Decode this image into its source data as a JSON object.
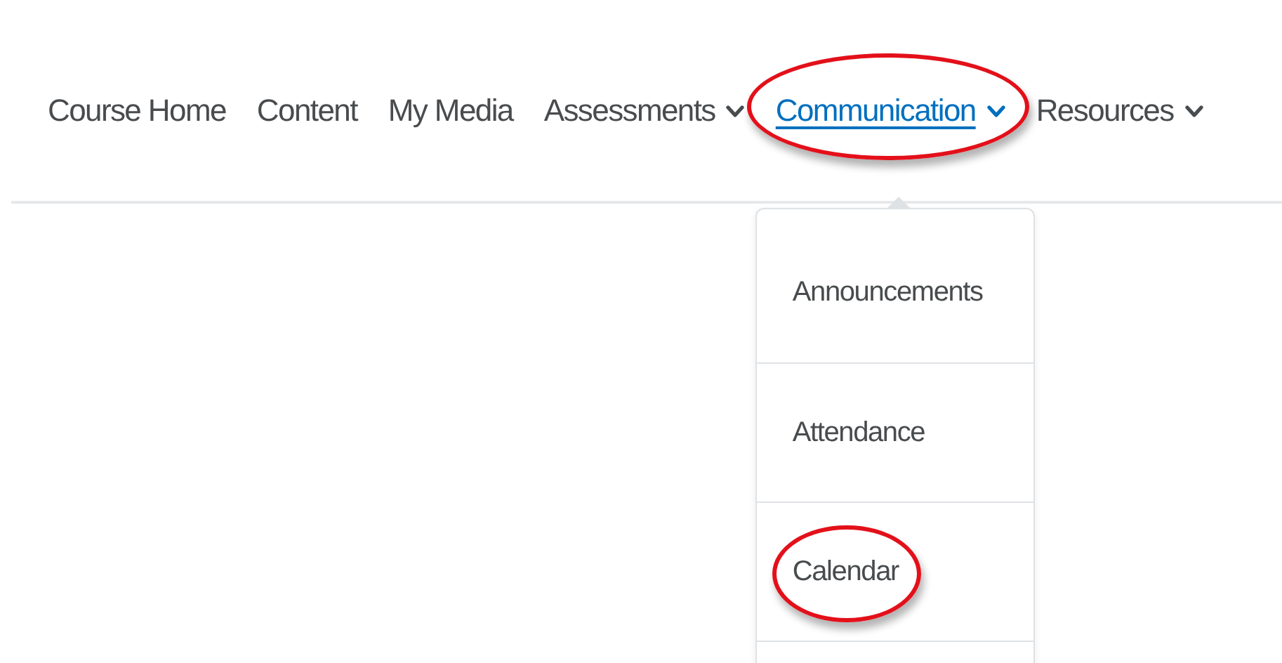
{
  "nav": {
    "items": [
      {
        "label": "Course Home",
        "has_menu": false,
        "selected": false,
        "highlighted": false
      },
      {
        "label": "Content",
        "has_menu": false,
        "selected": false,
        "highlighted": false
      },
      {
        "label": "My Media",
        "has_menu": false,
        "selected": false,
        "highlighted": false
      },
      {
        "label": "Assessments",
        "has_menu": true,
        "selected": false,
        "highlighted": false
      },
      {
        "label": "Communication",
        "has_menu": true,
        "selected": true,
        "highlighted": true
      },
      {
        "label": "Resources",
        "has_menu": true,
        "selected": false,
        "highlighted": false
      }
    ]
  },
  "dropdown": {
    "items": [
      {
        "label": "Announcements",
        "highlighted": false
      },
      {
        "label": "Attendance",
        "highlighted": false
      },
      {
        "label": "Calendar",
        "highlighted": true
      }
    ]
  }
}
